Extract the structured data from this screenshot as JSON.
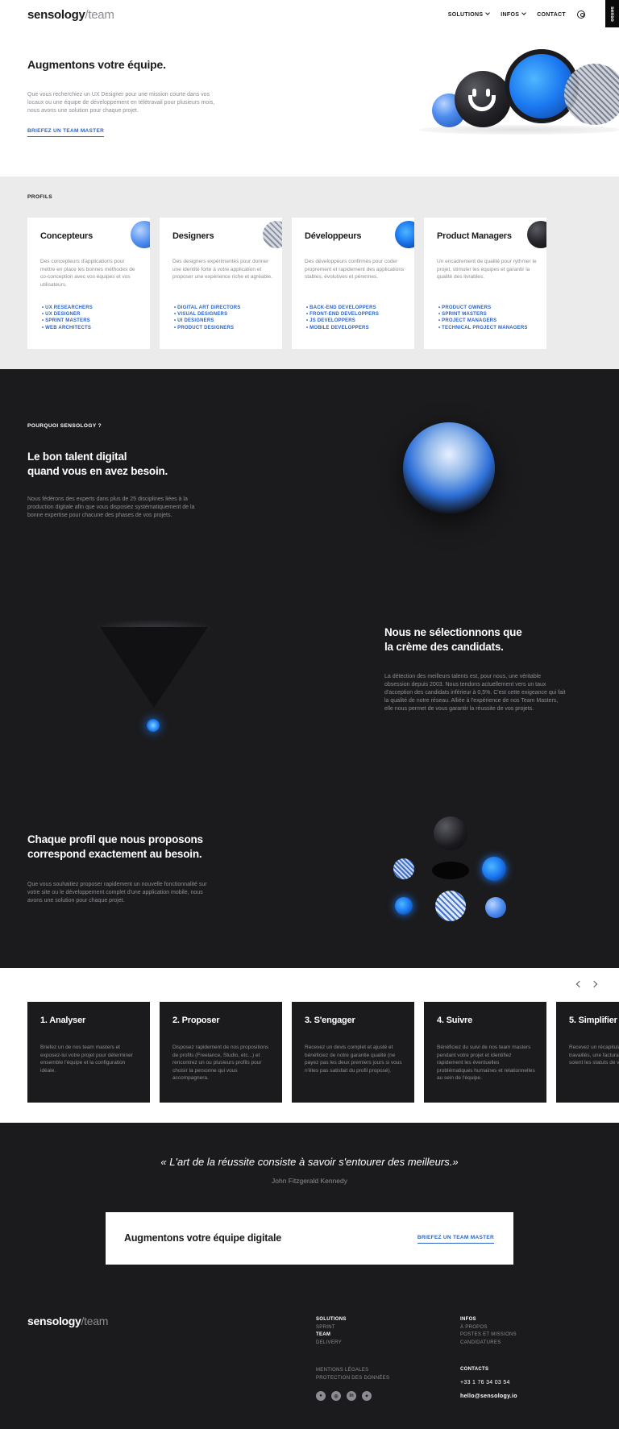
{
  "header": {
    "logo_main": "sensology",
    "logo_sub": "/team",
    "nav": [
      {
        "label": "SOLUTIONS"
      },
      {
        "label": "INFOS"
      },
      {
        "label": "CONTACT"
      }
    ],
    "side_tab": "senso"
  },
  "hero": {
    "title": "Augmentons votre équipe.",
    "text": "Que vous recherchiez un UX Designer pour une mission courte dans vos locaux ou une équipe de développement en télétravail pour plusieurs mois, nous avons une solution pour chaque projet.",
    "cta": "BRIEFEZ UN TEAM MASTER"
  },
  "profils": {
    "label": "PROFILS",
    "cards": [
      {
        "title": "Concepteurs",
        "text": "Des concepteurs d'applications pour mettre en place les bonnes méthodes de co-conception avec vos équipes et vos utilisateurs.",
        "items": [
          "UX RESEARCHERS",
          "UX DESIGNER",
          "SPRINT MASTERS",
          "WEB ARCHITECTS"
        ]
      },
      {
        "title": "Designers",
        "text": "Des designers expérimentés pour donner une identité forte à votre application et proposer une expérience riche et agréable.",
        "items": [
          "DIGITAL ART DIRECTORS",
          "VISUAL DESIGNERS",
          "UI DESIGNERS",
          "PRODUCT DESIGNERS"
        ]
      },
      {
        "title": "Développeurs",
        "text": "Des développeurs confirmés pour coder proprement et rapidement des applications stables, évolutives et pérennes.",
        "items": [
          "BACK-END DEVELOPPERS",
          "FRONT-END DEVELOPPERS",
          "JS DEVELOPPERS",
          "MOBILE DEVELOPPERS"
        ]
      },
      {
        "title": "Product Managers",
        "text": "Un encadrement de qualité pour rythmer le projet, stimuler les équipes et garantir la qualité des livrables.",
        "items": [
          "PRODUCT OWNERS",
          "SPRINT MASTERS",
          "PROJECT MANAGERS",
          "TECHNICAL PROJECT MANAGERS"
        ]
      }
    ]
  },
  "why": {
    "label": "POURQUOI SENSOLOGY ?",
    "block1": {
      "title_l1": "Le bon talent digital",
      "title_l2": "quand vous en avez besoin.",
      "text": "Nous fédérons des experts dans plus de 25 disciplines liées à la production digitale afin que vous disposiez systématiquement de la bonne expertise pour chacune des phases de vos projets."
    },
    "block2": {
      "title_l1": "Nous ne sélectionnons que",
      "title_l2": "la crème des candidats.",
      "text": "La détection des meilleurs talents est, pour nous, une véritable obsession depuis 2003. Nous tendons actuellement vers un taux d'acception des candidats inférieur à 0,5%. C'est cette exigeance qui fait la qualité de notre réseau. Alliée à l'expérience de nos Team Masters, elle nous permet de vous garantir la réussite de vos projets."
    },
    "block3": {
      "title_l1": "Chaque profil que nous proposons",
      "title_l2": "correspond exactement au besoin.",
      "text": "Que vous souhaitiez proposer rapidement un nouvelle fonctionnalité sur votre site ou le développement complet d'une application mobile, nous avons une solution pour chaque projet."
    }
  },
  "steps": [
    {
      "title": "1. Analyser",
      "text": "Briefez un de nos team masters et exposez-lui votre projet pour déterminer ensemble l'équipe et la configuration idéale."
    },
    {
      "title": "2. Proposer",
      "text": "Disposez rapidement de nos propositions de profils (Freelance, Studio, etc...) et rencontrez un ou plusieurs profils pour choisir la personne qui vous accompagnera."
    },
    {
      "title": "3. S'engager",
      "text": "Recevez un devis complet et ajusté et bénéficiez de notre garantie qualité (ne payez pas les deux premiers jours si vous n'êtes pas satisfait du profil proposé)."
    },
    {
      "title": "4. Suivre",
      "text": "Bénéficiez du suivi de nos team masters pendant votre projet et identifiez rapidement les éventuelles problématiques humaines et relationnelles au sein de l'équipe."
    },
    {
      "title": "5. Simplifier",
      "text": "Recevez un récapitulatif des jours travaillés, une facturation simplifiée et soient les statuts de vos mobilisés."
    }
  ],
  "quote": {
    "text": "« L'art de la réussite consiste à savoir s'entourer des meilleurs.»",
    "author": "John Fitzgerald Kennedy"
  },
  "cta_box": {
    "title": "Augmentons votre équipe digitale",
    "link": "BRIEFEZ UN TEAM MASTER"
  },
  "footer": {
    "logo_main": "sensology",
    "logo_sub": "/team",
    "solutions": {
      "head": "SOLUTIONS",
      "items": [
        "SPRINT",
        "TEAM",
        "DELIVERY"
      ]
    },
    "infos": {
      "head": "INFOS",
      "items": [
        "À PROPOS",
        "POSTES ET MISSIONS",
        "CANDIDATURES"
      ]
    },
    "legal": [
      "MENTIONS LÉGALES",
      "PROTECTION DES DONNÉES"
    ],
    "contacts": {
      "head": "CONTACTS",
      "phone": "+33 1 76 34 03 54",
      "email": "hello@sensology.io"
    },
    "socials": [
      "github-icon",
      "dribbble-icon",
      "linkedin-icon",
      "twitter-icon"
    ]
  },
  "colors": {
    "dark": "#1b1b1d",
    "accent_blue": "#2a63c8",
    "muted": "#8c8c93",
    "light_band": "#ebebec"
  }
}
